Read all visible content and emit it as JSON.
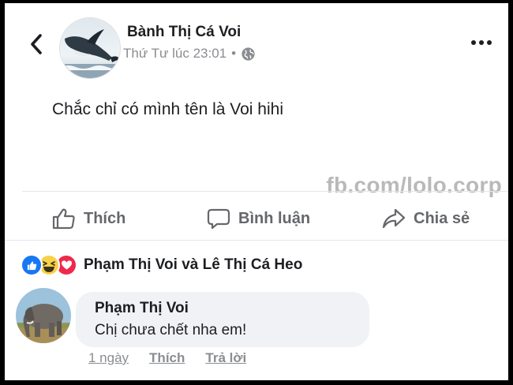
{
  "post": {
    "author": "Bành Thị Cá Voi",
    "time": "Thứ Tư lúc 23:01",
    "separator": "•",
    "privacy_icon": "globe-icon",
    "text": "Chắc chỉ có mình tên là Voi hihi",
    "watermark": "fb.com/lolo.corp"
  },
  "actions": {
    "like_label": "Thích",
    "comment_label": "Bình luận",
    "share_label": "Chia sẻ"
  },
  "reactions": {
    "icons": [
      "like-reaction-icon",
      "haha-reaction-icon",
      "love-reaction-icon"
    ],
    "names": "Phạm Thị Voi và Lê Thị Cá Heo"
  },
  "comment": {
    "author": "Phạm Thị Voi",
    "text": "Chị chưa chết nha em!",
    "time": "1 ngày",
    "like_label": "Thích",
    "reply_label": "Trả lời"
  },
  "colors": {
    "accent_blue": "#1877f2",
    "text_primary": "#1c1e21",
    "text_secondary": "#65676b",
    "bubble_bg": "#f0f2f5",
    "frame_border": "#000000"
  }
}
